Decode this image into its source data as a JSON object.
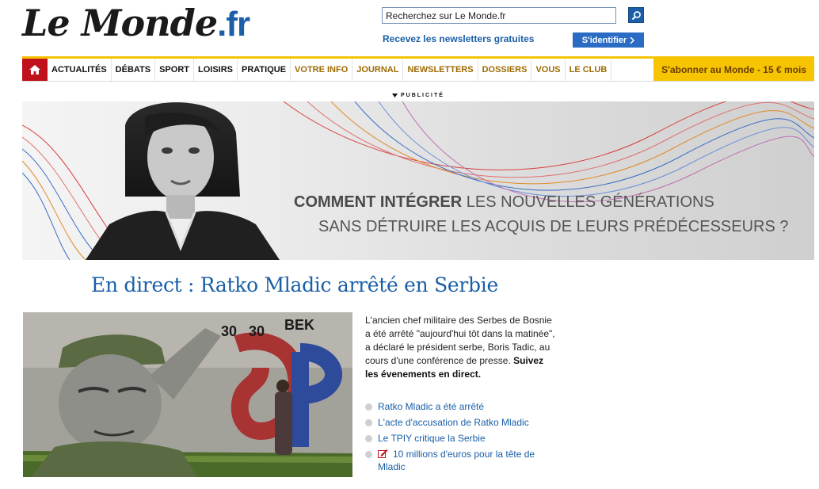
{
  "header": {
    "logo_le": "Le Monde",
    "logo_fr": ".fr",
    "search_value": "Recherchez sur Le Monde.fr",
    "newsletter_link": "Recevez les newsletters gratuites",
    "login_label": "S'identifier",
    "login_icon": "chevron-right-icon"
  },
  "nav": {
    "home_icon": "home-icon",
    "items": [
      {
        "label": "ACTUALITÉS"
      },
      {
        "label": "DÉBATS"
      },
      {
        "label": "SPORT"
      },
      {
        "label": "LOISIRS"
      },
      {
        "label": "PRATIQUE"
      },
      {
        "label": "VOTRE INFO"
      },
      {
        "label": "JOURNAL"
      },
      {
        "label": "NEWSLETTERS"
      },
      {
        "label": "DOSSIERS"
      },
      {
        "label": "VOUS"
      },
      {
        "label": "LE CLUB"
      }
    ],
    "subscribe": "S'abonner au Monde - 15 € mois"
  },
  "ad": {
    "label": "PUBLICITÉ",
    "line1_bold": "COMMENT INTÉGRER",
    "line1_rest": " LES NOUVELLES GÉNÉRATIONS",
    "line2": "SANS DÉTRUIRE LES ACQUIS DE LEURS PRÉDÉCESSEURS ?"
  },
  "article": {
    "headline": "En direct : Ratko Mladic arrêté en Serbie",
    "summary": "L'ancien chef militaire des Serbes de Bosnie a été arrêté \"aujourd'hui tôt dans la matinée\", a déclaré le président serbe, Boris Tadic, au cours d'une conférence de presse.",
    "summary_bold": "Suivez les évenements en direct.",
    "related": [
      {
        "label": "Ratko Mladic a été arrêté",
        "icon": ""
      },
      {
        "label": "L'acte d'accusation de Ratko Mladic",
        "icon": ""
      },
      {
        "label": "Le TPIY critique la Serbie",
        "icon": ""
      },
      {
        "label": "10 millions d'euros pour la tête de Mladic",
        "icon": "edit-icon"
      }
    ]
  },
  "colors": {
    "brand_blue": "#1a5fa8",
    "nav_red": "#c0121d",
    "gold": "#f6c400"
  }
}
